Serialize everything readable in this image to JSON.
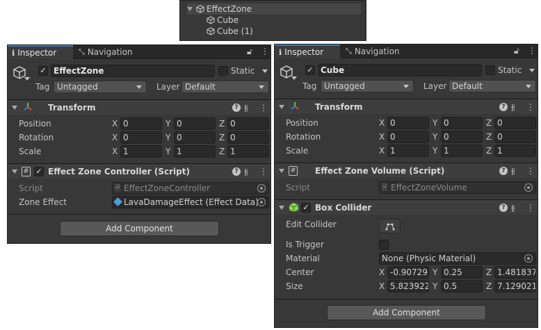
{
  "hierarchy": {
    "root": "EffectZone",
    "children": [
      "Cube",
      "Cube (1)"
    ]
  },
  "left": {
    "tabs": {
      "inspector": "Inspector",
      "navigation": "Navigation"
    },
    "object_name": "EffectZone",
    "static_label": "Static",
    "tag_label": "Tag",
    "tag_value": "Untagged",
    "layer_label": "Layer",
    "layer_value": "Default",
    "transform": {
      "title": "Transform",
      "position_label": "Position",
      "rotation_label": "Rotation",
      "scale_label": "Scale",
      "position": {
        "x": "0",
        "y": "0",
        "z": "0"
      },
      "rotation": {
        "x": "0",
        "y": "0",
        "z": "0"
      },
      "scale": {
        "x": "1",
        "y": "1",
        "z": "1"
      }
    },
    "controller": {
      "title": "Effect Zone Controller (Script)",
      "script_label": "Script",
      "script_value": "EffectZoneController",
      "zone_effect_label": "Zone Effect",
      "zone_effect_value": "LavaDamageEffect (Effect Data)"
    },
    "add_component": "Add Component"
  },
  "right": {
    "tabs": {
      "inspector": "Inspector",
      "navigation": "Navigation"
    },
    "object_name": "Cube",
    "static_label": "Static",
    "tag_label": "Tag",
    "tag_value": "Untagged",
    "layer_label": "Layer",
    "layer_value": "Default",
    "transform": {
      "title": "Transform",
      "position_label": "Position",
      "rotation_label": "Rotation",
      "scale_label": "Scale",
      "position": {
        "x": "0",
        "y": "0",
        "z": "0"
      },
      "rotation": {
        "x": "0",
        "y": "0",
        "z": "0"
      },
      "scale": {
        "x": "1",
        "y": "1",
        "z": "1"
      }
    },
    "volume": {
      "title": "Effect Zone Volume (Script)",
      "script_label": "Script",
      "script_value": "EffectZoneVolume"
    },
    "box_collider": {
      "title": "Box Collider",
      "edit_collider_label": "Edit Collider",
      "is_trigger_label": "Is Trigger",
      "material_label": "Material",
      "material_value": "None (Physic Material)",
      "center_label": "Center",
      "size_label": "Size",
      "center": {
        "x": "-0.90729",
        "y": "0.25",
        "z": "1.481837"
      },
      "size": {
        "x": "5.823922",
        "y": "0.5",
        "z": "7.129021"
      }
    },
    "add_component": "Add Component"
  },
  "axis_labels": {
    "x": "X",
    "y": "Y",
    "z": "Z"
  },
  "colors": {
    "panel": "#383838",
    "field": "#2a2a2a",
    "header": "#3e3e3e",
    "accent": "#3a79bb"
  }
}
